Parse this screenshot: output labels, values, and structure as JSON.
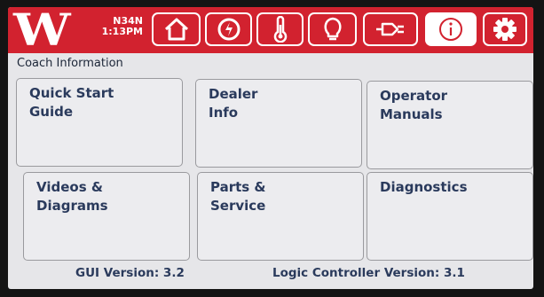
{
  "header": {
    "logo_text": "W",
    "coach_id": "N34N",
    "time": "1:13PM",
    "nav_buttons": [
      {
        "name": "home-icon"
      },
      {
        "name": "power-icon"
      },
      {
        "name": "thermometer-icon"
      },
      {
        "name": "lightbulb-icon"
      },
      {
        "name": "plug-icon"
      },
      {
        "name": "info-icon",
        "active": true
      },
      {
        "name": "gear-icon"
      }
    ]
  },
  "page": {
    "title": "Coach Information"
  },
  "tiles": [
    {
      "label": "Quick Start\nGuide"
    },
    {
      "label": "Dealer\nInfo"
    },
    {
      "label": "Operator\nManuals"
    },
    {
      "label": "Videos &\nDiagrams"
    },
    {
      "label": "Parts &\nService"
    },
    {
      "label": "Diagnostics"
    }
  ],
  "footer": {
    "gui_version": "GUI Version: 3.2",
    "logic_version": "Logic Controller Version: 3.1"
  },
  "colors": {
    "header_red": "#d2222f",
    "screen_bg": "#e6e6e9",
    "text_navy": "#2a3a5c"
  }
}
